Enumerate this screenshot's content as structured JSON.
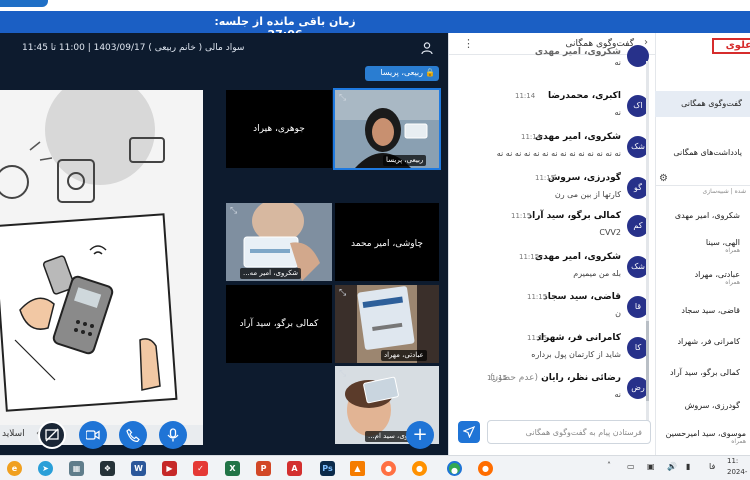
{
  "timer": {
    "label": "زمان باقی مانده از جلسه: 27:06"
  },
  "session": {
    "info": "سواد مالی ( خانم ربیعی ) 1403/09/17 | 11:00 تا 11:45",
    "presenter": "ربیعی، پریسا"
  },
  "slide": {
    "footer_text": "اسلاید"
  },
  "tiles": [
    {
      "name": "جوهری، هیراد"
    },
    {
      "name": "ربیعی، پریسا"
    },
    {
      "name": "شکروی، امیر مه..."
    },
    {
      "name": "چاوشی، امیر محمد"
    },
    {
      "name": "کمالی برگو، سید آراد"
    },
    {
      "name": "عبادتی، مهراد"
    },
    {
      "name": "موسوی، سید ام..."
    }
  ],
  "chat": {
    "title": "گفت‌وگوی همگانی",
    "input_placeholder": "فرستادن پیام به گفت‌وگوی همگانی",
    "top_partial_name": "شکروی، امیر مهدی",
    "top_partial_text": "نه",
    "messages": [
      {
        "avatar": "اک",
        "name": "اکبری، محمدرضا",
        "time": "11:14",
        "text": "نه"
      },
      {
        "avatar": "شک",
        "name": "شکروی، امیر مهدی",
        "time": "11:14",
        "text": "نه نه نه نه نه نه نه نه نه نه نه نه نه نه"
      },
      {
        "avatar": "گو",
        "name": "گودرزی، سروش",
        "time": "11:15",
        "text": "کارتها از بین می رن"
      },
      {
        "avatar": "کم",
        "name": "کمالی برگو، سید آراد",
        "time": "11:15",
        "text": "CVV2"
      },
      {
        "avatar": "شک",
        "name": "شکروی، امیر مهدی",
        "time": "11:15",
        "text": "بله من میمیرم"
      },
      {
        "avatar": "قا",
        "name": "قاضی، سید سجاد",
        "time": "11:15",
        "text": "ن"
      },
      {
        "avatar": "کا",
        "name": "کامرانی فر، شهراد",
        "time": "11:15",
        "text": "شاید از کارتمان پول برداره"
      },
      {
        "avatar": "رض",
        "name": "رضائی نظر، رایان",
        "status": "(عدم حضور)",
        "time": "11:15",
        "text": "نه"
      }
    ]
  },
  "sidebar": {
    "logo": "علوی",
    "items": [
      {
        "label": "گفت‌وگوی همگانی",
        "sub": ""
      },
      {
        "label": "یادداشت‌های همگانی",
        "sub": ""
      },
      {
        "label": "",
        "sub": "شده | شبیه‌سازی"
      },
      {
        "label": "شکروی، امیر مهدی",
        "sub": ""
      },
      {
        "label": "الهی، سینا",
        "sub": "همراه"
      },
      {
        "label": "عبادتی، مهراد",
        "sub": "همراه"
      },
      {
        "label": "قاضی، سید سجاد",
        "sub": ""
      },
      {
        "label": "کامرانی فر، شهراد",
        "sub": ""
      },
      {
        "label": "کمالی برگو، سید آراد",
        "sub": ""
      },
      {
        "label": "گودرزی، سروش",
        "sub": ""
      },
      {
        "label": "موسوی، سید امیرحسین",
        "sub": "همراه"
      }
    ]
  },
  "taskbar": {
    "lang": "فا",
    "clock_time": "11:",
    "clock_date": "2024-"
  },
  "colors": {
    "accent": "#1f74d6",
    "timer_bar": "#1b5fc4",
    "dark_bg": "#0d1b2e",
    "avatar": "#27318a",
    "logo": "#d62c2c"
  }
}
